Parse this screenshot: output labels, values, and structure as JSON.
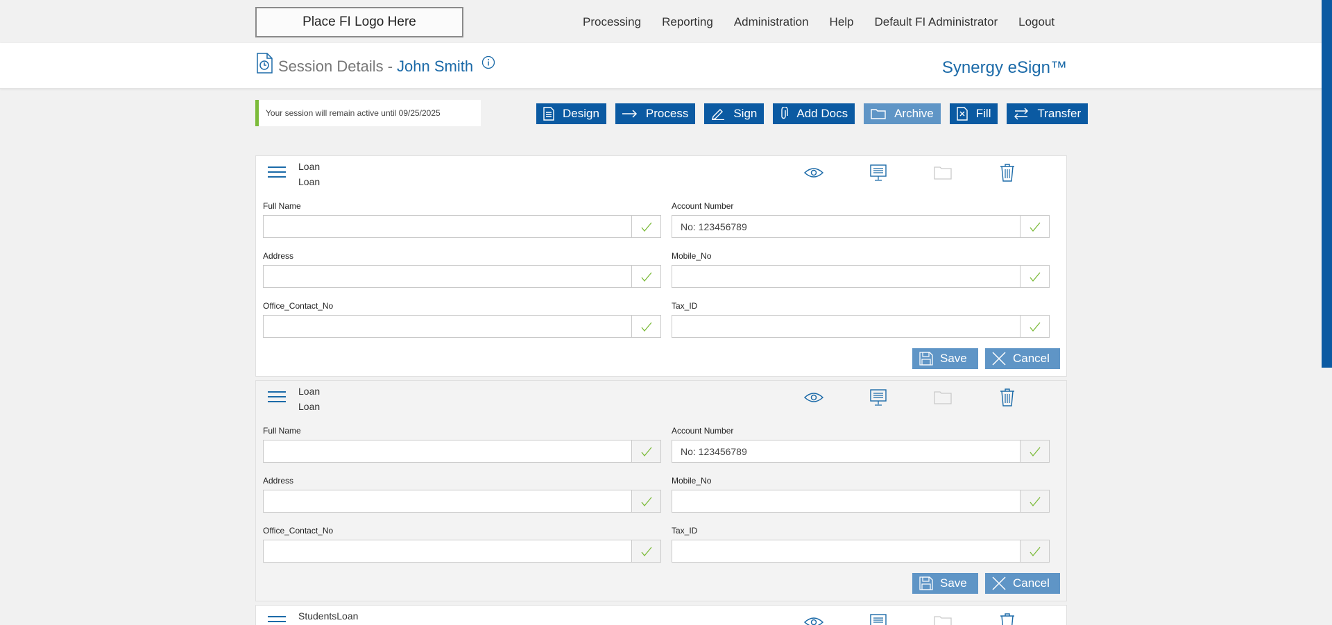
{
  "topbar": {
    "logo_text": "Place FI Logo Here",
    "nav": [
      "Processing",
      "Reporting",
      "Administration",
      "Help",
      "Default FI Administrator",
      "Logout"
    ]
  },
  "header": {
    "title": "Session Details -",
    "name": "John Smith",
    "brand": "Synergy eSign™"
  },
  "banner": {
    "text": "Your session will remain active until 09/25/2025"
  },
  "toolbar": {
    "design": "Design",
    "process": "Process",
    "sign": "Sign",
    "add_docs": "Add Docs",
    "archive": "Archive",
    "fill": "Fill",
    "transfer": "Transfer"
  },
  "cards": [
    {
      "title1": "Loan",
      "title2": "Loan",
      "fields": {
        "full_name": {
          "label": "Full Name",
          "value": ""
        },
        "account_number": {
          "label": "Account Number",
          "value": "No: 123456789"
        },
        "address": {
          "label": "Address",
          "value": ""
        },
        "mobile_no": {
          "label": "Mobile_No",
          "value": ""
        },
        "office_contact_no": {
          "label": "Office_Contact_No",
          "value": ""
        },
        "tax_id": {
          "label": "Tax_ID",
          "value": ""
        }
      },
      "save": "Save",
      "cancel": "Cancel"
    },
    {
      "title1": "Loan",
      "title2": "Loan",
      "fields": {
        "full_name": {
          "label": "Full Name",
          "value": ""
        },
        "account_number": {
          "label": "Account Number",
          "value": "No: 123456789"
        },
        "address": {
          "label": "Address",
          "value": ""
        },
        "mobile_no": {
          "label": "Mobile_No",
          "value": ""
        },
        "office_contact_no": {
          "label": "Office_Contact_No",
          "value": ""
        },
        "tax_id": {
          "label": "Tax_ID",
          "value": ""
        }
      },
      "save": "Save",
      "cancel": "Cancel"
    },
    {
      "title1": "StudentsLoan"
    }
  ],
  "colors": {
    "primary": "#0b5aa2",
    "primary_disabled": "#5f95c6",
    "accent_green": "#7cbb3a",
    "link_blue": "#1b6aa8"
  },
  "icons": {
    "card_actions": [
      "eye-icon",
      "presentation-icon",
      "folder-icon",
      "trash-icon"
    ]
  }
}
